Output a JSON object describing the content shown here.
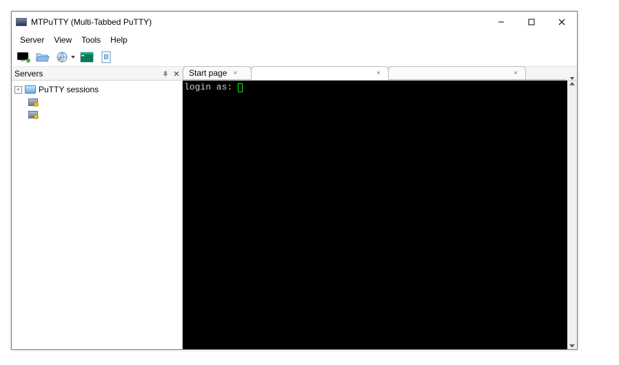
{
  "window": {
    "title": "MTPuTTY (Multi-Tabbed PuTTY)"
  },
  "menu": {
    "items": [
      "Server",
      "View",
      "Tools",
      "Help"
    ]
  },
  "toolbar": {
    "icons": [
      "monitor",
      "folder",
      "globe",
      "terminal",
      "script"
    ]
  },
  "servers_pane": {
    "title": "Servers",
    "root_node": {
      "label": "PuTTY sessions",
      "expanded": true
    }
  },
  "tabs": [
    {
      "label": "Start page",
      "active": false
    },
    {
      "label": "",
      "active": true
    },
    {
      "label": "",
      "active": false
    }
  ],
  "terminal": {
    "prompt": "login as: "
  }
}
